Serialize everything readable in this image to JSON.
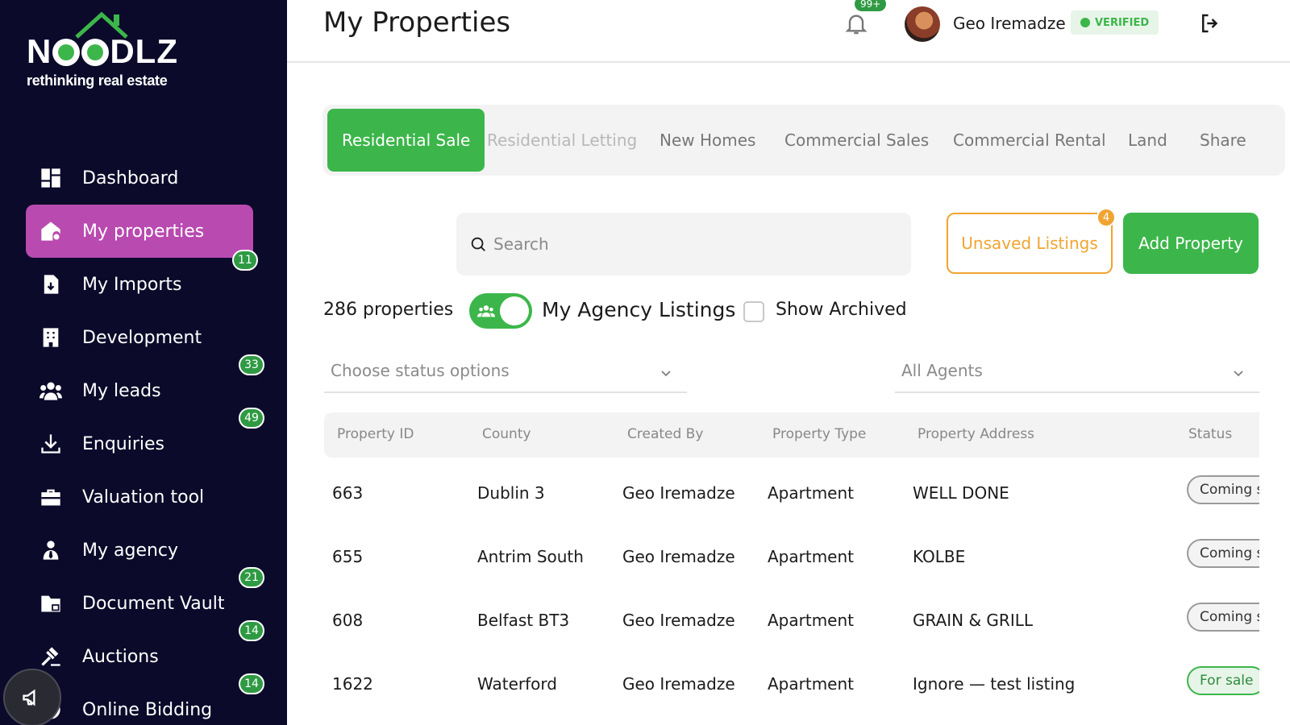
{
  "brand": {
    "logo_left": "N",
    "logo_right": "DLZ",
    "tagline": "rethinking real estate"
  },
  "sidebar": {
    "items": [
      {
        "label": "Dashboard",
        "icon": "dashboard-icon",
        "badge": null
      },
      {
        "label": "My properties",
        "icon": "house-key-icon",
        "badge": "11",
        "active": true
      },
      {
        "label": "My Imports",
        "icon": "file-import-icon",
        "badge": null
      },
      {
        "label": "Development",
        "icon": "building-icon",
        "badge": "33"
      },
      {
        "label": "My leads",
        "icon": "users-icon",
        "badge": "49"
      },
      {
        "label": "Enquiries",
        "icon": "download-icon",
        "badge": null
      },
      {
        "label": "Valuation tool",
        "icon": "toolbox-icon",
        "badge": null
      },
      {
        "label": "My agency",
        "icon": "agent-icon",
        "badge": "21"
      },
      {
        "label": "Document Vault",
        "icon": "folder-lock-icon",
        "badge": "14"
      },
      {
        "label": "Auctions",
        "icon": "gavel-icon",
        "badge": "14"
      },
      {
        "label": "Online Bidding",
        "icon": "bidding-icon",
        "badge": null
      }
    ]
  },
  "header": {
    "title": "My Properties",
    "notifications_badge": "99+",
    "user_name": "Geo Iremadze",
    "verified_label": "VERIFIED"
  },
  "tabs": [
    {
      "label": "Residential Sale",
      "state": "active"
    },
    {
      "label": "Residential Letting",
      "state": "muted"
    },
    {
      "label": "New Homes",
      "state": "normal"
    },
    {
      "label": "Commercial Sales",
      "state": "normal"
    },
    {
      "label": "Commercial Rental",
      "state": "normal"
    },
    {
      "label": "Land",
      "state": "normal"
    },
    {
      "label": "Share",
      "state": "normal"
    }
  ],
  "toolbar": {
    "search_placeholder": "Search",
    "unsaved_label": "Unsaved Listings",
    "unsaved_count": "4",
    "add_label": "Add Property"
  },
  "filters": {
    "count_label": "286 properties",
    "agency_toggle_label": "My Agency Listings",
    "agency_toggle_on": true,
    "archived_label": "Show Archived",
    "archived_checked": false,
    "status_placeholder": "Choose status options",
    "agents_value": "All Agents"
  },
  "table": {
    "columns": [
      "Property ID",
      "County",
      "Created By",
      "Property Type",
      "Property Address",
      "Status"
    ],
    "rows": [
      {
        "id": "663",
        "county": "Dublin 3",
        "created_by": "Geo Iremadze",
        "type": "Apartment",
        "address": "WELL DONE",
        "status": "Coming soon",
        "status_kind": "coming"
      },
      {
        "id": "655",
        "county": "Antrim South",
        "created_by": "Geo Iremadze",
        "type": "Apartment",
        "address": "KOLBE",
        "status": "Coming soon",
        "status_kind": "coming"
      },
      {
        "id": "608",
        "county": "Belfast BT3",
        "created_by": "Geo Iremadze",
        "type": "Apartment",
        "address": "GRAIN & GRILL",
        "status": "Coming soon",
        "status_kind": "coming"
      },
      {
        "id": "1622",
        "county": "Waterford",
        "created_by": "Geo Iremadze",
        "type": "Apartment",
        "address": "Ignore — test listing",
        "status": "For sale",
        "status_kind": "forsale"
      }
    ]
  },
  "colors": {
    "sidebar_bg": "#0b0a2a",
    "active_nav": "#b84ab0",
    "primary_green": "#3cb64a",
    "warning_orange": "#f0a431"
  }
}
